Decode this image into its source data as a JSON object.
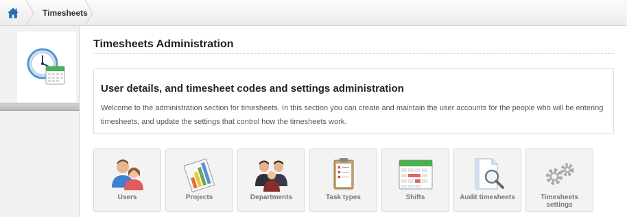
{
  "breadcrumb": {
    "home_icon": "home-icon",
    "current": "Timesheets"
  },
  "sidebar": {
    "icon": "timesheets-clock-calendar-icon"
  },
  "page": {
    "title": "Timesheets Administration"
  },
  "intro": {
    "heading": "User details, and timesheet codes and settings administration",
    "text": "Welcome to the administration section for timesheets. In this section you can create and maintain the user accounts for the people who will be entering timesheets, and update the settings that control how the timesheets work."
  },
  "tiles": [
    {
      "label": "Users",
      "icon": "users-icon"
    },
    {
      "label": "Projects",
      "icon": "projects-chart-icon"
    },
    {
      "label": "Departments",
      "icon": "departments-icon"
    },
    {
      "label": "Task types",
      "icon": "task-clipboard-icon"
    },
    {
      "label": "Shifts",
      "icon": "shifts-calendar-icon"
    },
    {
      "label": "Audit timesheets",
      "icon": "audit-magnifier-icon"
    },
    {
      "label": "Timesheets settings",
      "icon": "settings-gears-icon"
    }
  ],
  "colors": {
    "home_icon": "#2a6bb0",
    "tile_label": "#777777",
    "sidebar_bg": "#f1f1f1"
  }
}
